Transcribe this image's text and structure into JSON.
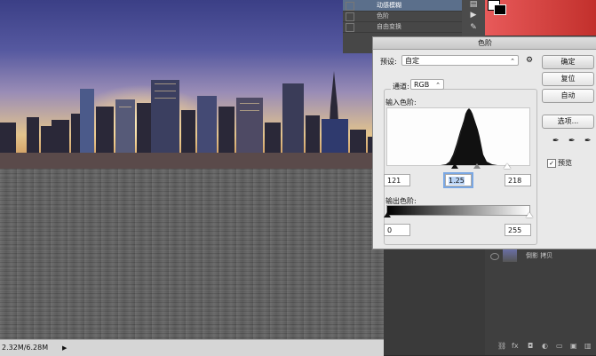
{
  "dialog": {
    "title": "色阶",
    "preset_label": "预设:",
    "preset_value": "自定",
    "channel_label": "通道:",
    "channel_value": "RGB",
    "input_levels_label": "输入色阶:",
    "input_black": "121",
    "input_gamma": "1.25",
    "input_white": "218",
    "output_levels_label": "输出色阶:",
    "output_black": "0",
    "output_white": "255",
    "buttons": {
      "ok": "确定",
      "reset": "复位",
      "auto": "自动",
      "options": "选项..."
    },
    "preview_label": "预览",
    "preview_checked": true
  },
  "layers": {
    "rows": [
      "动感模糊",
      "色阶",
      "自由变换"
    ],
    "copy_layer": "倒影 拷贝"
  },
  "status": {
    "doc_size": "2.32M/6.28M"
  },
  "colors": {
    "accent": "#7aa7e3",
    "selected_layer": "#5b6f8b",
    "dialog_bg": "#e9e9e9"
  },
  "icons": [
    "gear-icon",
    "eyedropper-black-icon",
    "eyedropper-gray-icon",
    "eyedropper-white-icon",
    "eye-icon",
    "chevron-down-icon"
  ]
}
